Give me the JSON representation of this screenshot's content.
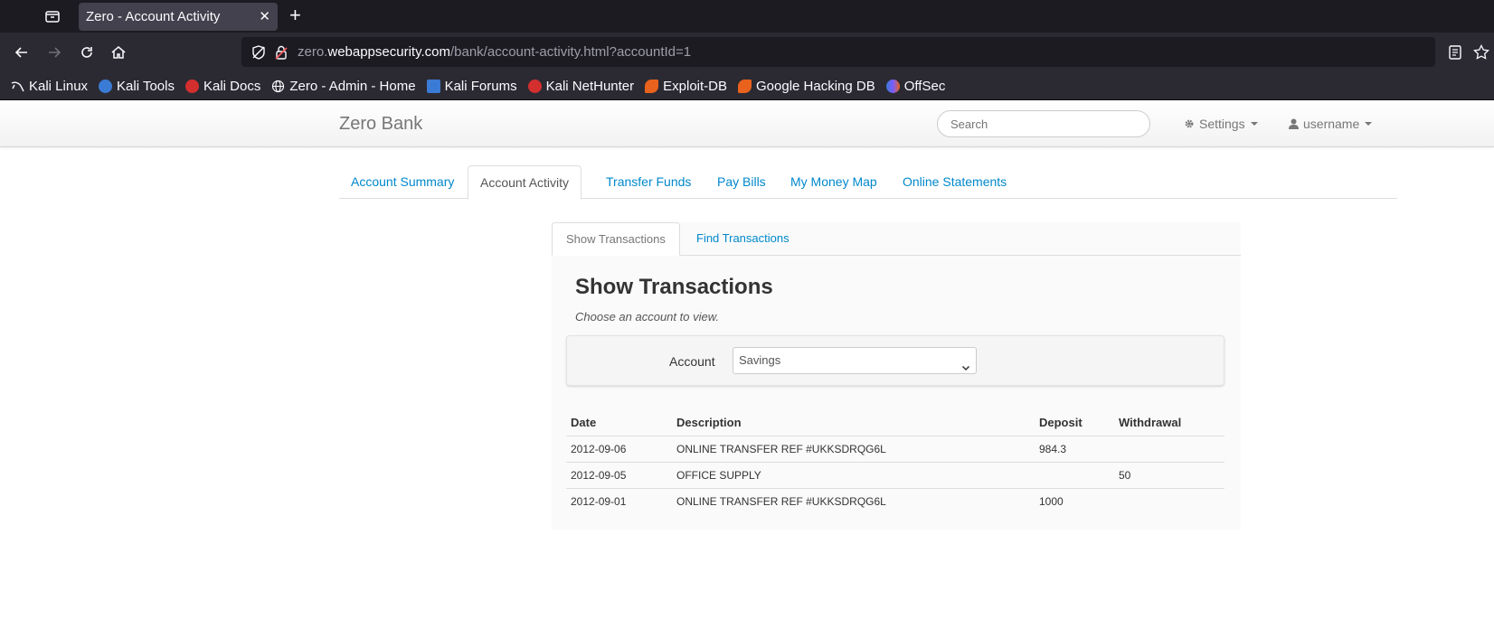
{
  "browser": {
    "tab_title": "Zero - Account Activity",
    "url_prefix": "zero.",
    "url_host": "webappsecurity.com",
    "url_path": "/bank/account-activity.html?accountId=1",
    "bookmarks": [
      {
        "label": "Kali Linux",
        "icon": "kali-linux-icon",
        "color": "#2f2f2f"
      },
      {
        "label": "Kali Tools",
        "icon": "kali-tools-icon",
        "color": "#3a7bd5"
      },
      {
        "label": "Kali Docs",
        "icon": "kali-docs-icon",
        "color": "#d32f2f"
      },
      {
        "label": "Zero - Admin - Home",
        "icon": "globe-icon",
        "color": "#fbfbfe"
      },
      {
        "label": "Kali Forums",
        "icon": "kali-forums-icon",
        "color": "#3a7bd5"
      },
      {
        "label": "Kali NetHunter",
        "icon": "kali-nethunter-icon",
        "color": "#d32f2f"
      },
      {
        "label": "Exploit-DB",
        "icon": "exploit-db-icon",
        "color": "#e8621d"
      },
      {
        "label": "Google Hacking DB",
        "icon": "google-hacking-db-icon",
        "color": "#e8621d"
      },
      {
        "label": "OffSec",
        "icon": "offsec-icon",
        "color": "#7a5cff"
      }
    ]
  },
  "header": {
    "brand": "Zero Bank",
    "search_placeholder": "Search",
    "settings_label": "Settings",
    "user_label": "username"
  },
  "main_tabs": [
    {
      "label": "Account Summary",
      "active": false
    },
    {
      "label": "Account Activity",
      "active": true
    },
    {
      "label": "Transfer Funds",
      "active": false
    },
    {
      "label": "Pay Bills",
      "active": false
    },
    {
      "label": "My Money Map",
      "active": false
    },
    {
      "label": "Online Statements",
      "active": false
    }
  ],
  "sub_tabs": [
    {
      "label": "Show Transactions",
      "active": true
    },
    {
      "label": "Find Transactions",
      "active": false
    }
  ],
  "section": {
    "title": "Show Transactions",
    "subtitle": "Choose an account to view."
  },
  "account_form": {
    "label": "Account",
    "selected": "Savings"
  },
  "transactions": {
    "headers": [
      "Date",
      "Description",
      "Deposit",
      "Withdrawal"
    ],
    "rows": [
      [
        "2012-09-06",
        "ONLINE TRANSFER REF #UKKSDRQG6L",
        "984.3",
        ""
      ],
      [
        "2012-09-05",
        "OFFICE SUPPLY",
        "",
        "50"
      ],
      [
        "2012-09-01",
        "ONLINE TRANSFER REF #UKKSDRQG6L",
        "1000",
        ""
      ]
    ]
  }
}
